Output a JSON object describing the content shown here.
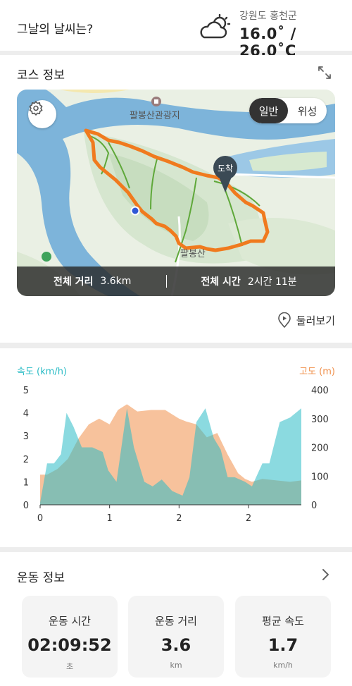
{
  "weather": {
    "label": "그날의 날씨는?",
    "icon": "partly-cloudy-icon",
    "location": "강원도 홍천군",
    "temperature": "16.0˚ / 26.0˚C"
  },
  "course": {
    "title": "코스 정보",
    "map": {
      "toggle_normal": "일반",
      "toggle_satellite": "위성",
      "poi_label": "팔봉산관광지",
      "peak_label": "팔봉산",
      "finish_label": "도착",
      "route_color": "#f07a1e",
      "trail_color": "#5fa83a",
      "water_color": "#6aa9d8"
    },
    "total_distance_label": "전체 거리",
    "total_distance_value": "3.6km",
    "total_time_label": "전체 시간",
    "total_time_value": "2시간 11분",
    "lookaround_label": "둘러보기"
  },
  "elevation_chart": {
    "left_axis_title": "속도 (km/h)",
    "right_axis_title": "고도 (m)",
    "left_color": "#2bbcc6",
    "right_color": "#f08f4a"
  },
  "chart_data": {
    "type": "area",
    "x_tick_labels": [
      "0",
      "1",
      "2",
      "2"
    ],
    "xlim": [
      0,
      3.76
    ],
    "x_ticks": [
      0,
      1,
      2,
      3
    ],
    "series": [
      {
        "name": "속도 (km/h)",
        "axis": "left",
        "color": "#2bbcc6",
        "x": [
          0,
          0.1,
          0.2,
          0.3,
          0.38,
          0.48,
          0.6,
          0.75,
          0.9,
          0.98,
          1.1,
          1.25,
          1.35,
          1.5,
          1.62,
          1.75,
          1.9,
          2.05,
          2.15,
          2.25,
          2.38,
          2.5,
          2.6,
          2.7,
          2.8,
          2.95,
          3.05,
          3.2,
          3.3,
          3.45,
          3.6,
          3.76
        ],
        "values": [
          0.1,
          1.8,
          1.8,
          2.2,
          4.0,
          3.4,
          2.5,
          2.5,
          2.3,
          1.5,
          1.0,
          4.2,
          2.5,
          1.0,
          0.8,
          1.1,
          0.6,
          0.4,
          1.2,
          3.6,
          4.2,
          2.9,
          2.4,
          1.2,
          1.2,
          1.0,
          0.8,
          1.8,
          1.8,
          3.6,
          3.8,
          4.2
        ]
      },
      {
        "name": "고도 (m)",
        "axis": "right",
        "color": "#f08f4a",
        "x": [
          0,
          0.1,
          0.25,
          0.4,
          0.55,
          0.7,
          0.85,
          1.0,
          1.12,
          1.25,
          1.4,
          1.6,
          1.8,
          2.0,
          2.1,
          2.25,
          2.4,
          2.55,
          2.7,
          2.85,
          2.95,
          3.05,
          3.2,
          3.4,
          3.6,
          3.76
        ],
        "values": [
          105,
          105,
          125,
          160,
          230,
          280,
          300,
          280,
          330,
          350,
          325,
          330,
          330,
          300,
          290,
          280,
          235,
          250,
          175,
          110,
          90,
          80,
          90,
          85,
          80,
          85
        ]
      }
    ],
    "y_left": {
      "ylim": [
        0,
        5
      ],
      "ticks": [
        0,
        1,
        2,
        3,
        4,
        5
      ]
    },
    "y_right": {
      "ylim": [
        0,
        400
      ],
      "ticks": [
        0,
        100,
        200,
        300,
        400
      ]
    },
    "grid": false
  },
  "exercise": {
    "title": "운동 정보",
    "stats": [
      {
        "name": "운동 시간",
        "value": "02:09:52",
        "unit": "초"
      },
      {
        "name": "운동 거리",
        "value": "3.6",
        "unit": "km"
      },
      {
        "name": "평균 속도",
        "value": "1.7",
        "unit": "km/h"
      }
    ]
  }
}
